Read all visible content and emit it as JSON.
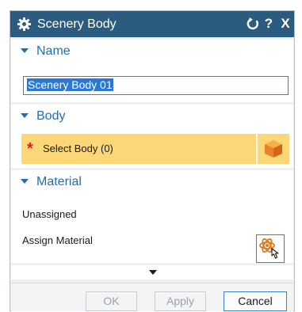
{
  "dialog": {
    "title": "Scenery Body",
    "title_icon": "gear-icon",
    "reset_icon": "reset-icon",
    "help_label": "?",
    "close_label": "X"
  },
  "name_section": {
    "header": "Name",
    "value": "Scenery Body 01"
  },
  "body_section": {
    "header": "Body",
    "required_marker": "*",
    "select_label": "Select Body (0)",
    "select_icon": "cube-icon"
  },
  "material_section": {
    "header": "Material",
    "status": "Unassigned",
    "assign_label": "Assign Material",
    "assign_icon": "assign-material-icon"
  },
  "footer": {
    "ok_label": "OK",
    "apply_label": "Apply",
    "cancel_label": "Cancel"
  },
  "colors": {
    "titlebar": "#2b5b7f",
    "section_header": "#1f6fb0",
    "selection_highlight": "#fbd777",
    "required": "#e02020"
  }
}
